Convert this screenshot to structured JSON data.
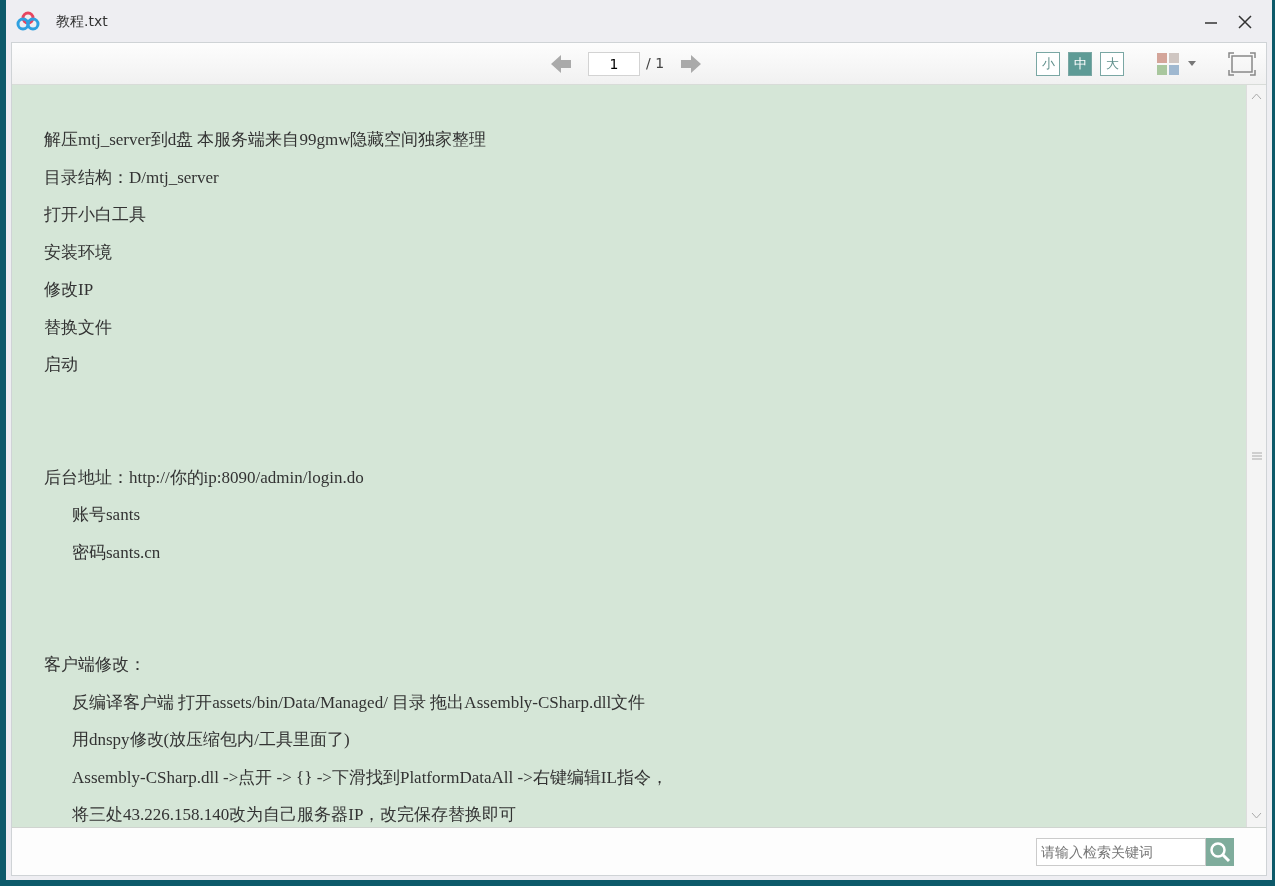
{
  "window": {
    "title": "教程.txt"
  },
  "toolbar": {
    "page_input": "1",
    "page_total": "/ 1",
    "font_sizes": [
      {
        "label": "小",
        "selected": false
      },
      {
        "label": "中",
        "selected": true
      },
      {
        "label": "大",
        "selected": false
      }
    ]
  },
  "document": {
    "blocks": [
      {
        "lines": [
          {
            "text": "解压mtj_server到d盘  本服务端来自99gmw隐藏空间独家整理"
          },
          {
            "text": "目录结构：D/mtj_server"
          },
          {
            "text": "打开小白工具"
          },
          {
            "text": "安装环境"
          },
          {
            "text": "修改IP"
          },
          {
            "text": "替换文件"
          },
          {
            "text": "启动"
          }
        ]
      },
      {
        "lines": [
          {
            "text": "后台地址：http://你的ip:8090/admin/login.do",
            "children": [
              {
                "text": "账号sants"
              },
              {
                "text": "密码sants.cn"
              }
            ]
          }
        ]
      },
      {
        "lines": [
          {
            "text": "客户端修改：",
            "children": [
              {
                "text": "反编译客户端  打开assets/bin/Data/Managed/ 目录 拖出Assembly-CSharp.dll文件"
              },
              {
                "text": "用dnspy修改(放压缩包内/工具里面了)"
              },
              {
                "text": "Assembly-CSharp.dll ->点开 -> {} ->下滑找到PlatformDataAll ->右键编辑IL指令，"
              },
              {
                "text": "将三处43.226.158.140改为自己服务器IP，改完保存替换即可"
              }
            ]
          }
        ]
      }
    ]
  },
  "search": {
    "placeholder": "请输入检索关键词"
  }
}
